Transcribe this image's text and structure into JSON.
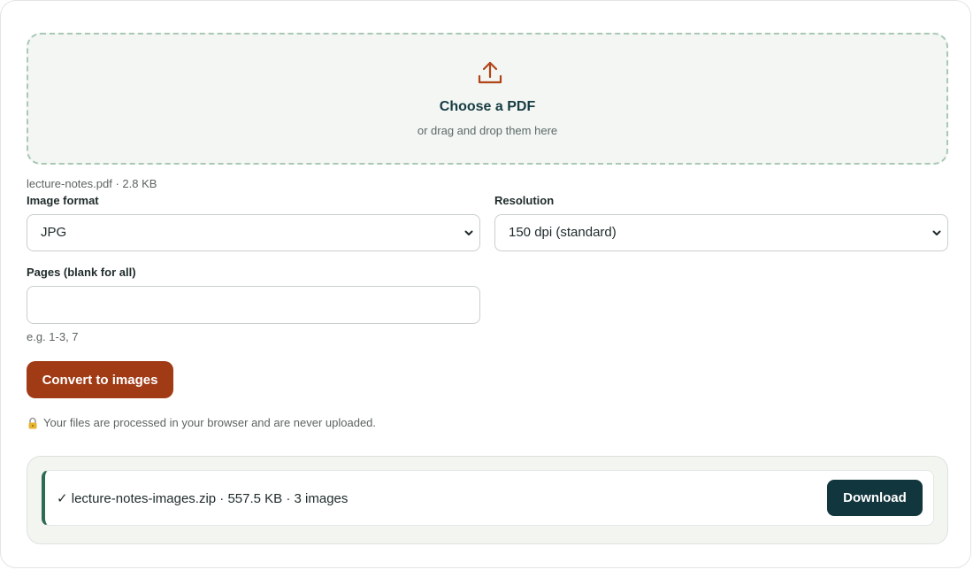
{
  "dropzone": {
    "icon": "upload-icon",
    "title": "Choose a PDF",
    "subtitle": "or drag and drop them here"
  },
  "file_info": "lecture-notes.pdf · 2.8 KB",
  "image_format": {
    "label": "Image format",
    "selected": "JPG"
  },
  "resolution": {
    "label": "Resolution",
    "selected": "150 dpi (standard)"
  },
  "pages": {
    "label": "Pages (blank for all)",
    "value": "",
    "hint": "e.g. 1-3, 7"
  },
  "convert_label": "Convert to images",
  "privacy_note": "Your files are processed in your browser and are never uploaded.",
  "result": {
    "text": "✓ lecture-notes-images.zip · 557.5 KB · 3 images",
    "download_label": "Download"
  },
  "colors": {
    "accent": "#a03b16",
    "primary_dark": "#12363d",
    "success_border": "#2f6b54"
  }
}
